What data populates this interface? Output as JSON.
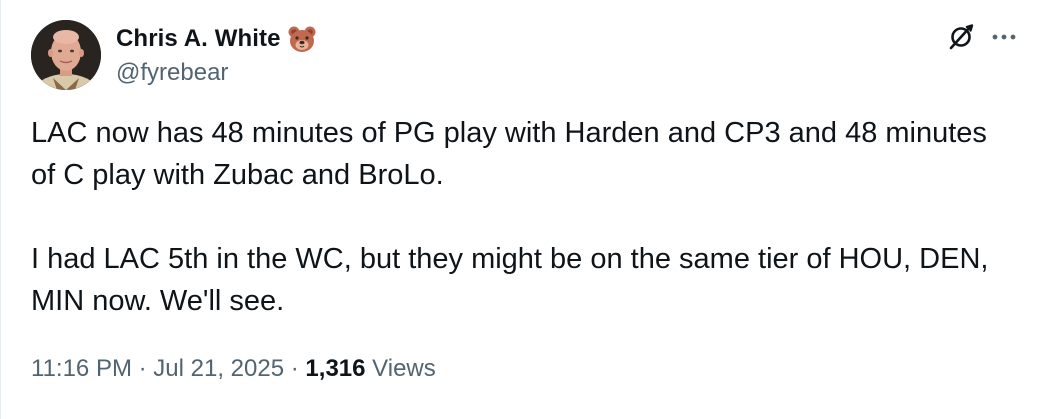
{
  "author": {
    "display_name": "Chris A. White",
    "name_emoji": "bear-face-icon",
    "handle": "@fyrebear",
    "avatar": "avatar"
  },
  "actions": {
    "grok_icon": "grok-icon",
    "more_icon": "more-icon"
  },
  "tweet": {
    "paragraph_1": "LAC now has 48 minutes of PG play with Harden and CP3 and 48 minutes of C play with Zubac and BroLo.",
    "paragraph_2": "I had LAC 5th in the WC, but they might be on the same tier of HOU, DEN, MIN now. We'll see."
  },
  "meta": {
    "time": "11:16 PM",
    "separator": "·",
    "date": "Jul 21, 2025",
    "views_count": "1,316",
    "views_label": "Views"
  },
  "colors": {
    "text_primary": "#0f1419",
    "text_secondary": "#536471",
    "background": "#ffffff"
  }
}
